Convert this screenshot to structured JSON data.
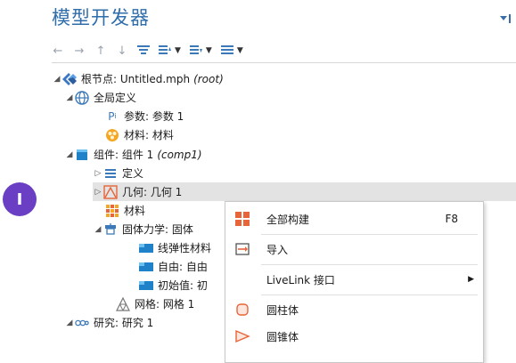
{
  "panel": {
    "title": "模型开发器",
    "pin_icon": "pin-dropdown-icon"
  },
  "toolbar": {
    "buttons": [
      {
        "icon": "arrow-left-icon",
        "glyph": "←"
      },
      {
        "icon": "arrow-right-icon",
        "glyph": "→"
      },
      {
        "icon": "arrow-up-icon",
        "glyph": "↑"
      },
      {
        "icon": "arrow-down-icon",
        "glyph": "↓"
      },
      {
        "icon": "filter-icon",
        "glyph": "≡"
      },
      {
        "icon": "expand-sort-icon",
        "glyph": "☰"
      },
      {
        "icon": "collapse-sort-icon",
        "glyph": "☰"
      },
      {
        "icon": "list-options-icon",
        "glyph": "☰"
      }
    ]
  },
  "tree": {
    "root": {
      "label": "根节点: Untitled.mph",
      "suffix": "(root)"
    },
    "global_defs": {
      "label": "全局定义"
    },
    "params": {
      "label": "参数: 参数 1"
    },
    "materials_global": {
      "label": "材料: 材料"
    },
    "component": {
      "label": "组件: 组件 1",
      "suffix": "(comp1)"
    },
    "definitions": {
      "label": "定义"
    },
    "geometry": {
      "label": "几何: 几何 1"
    },
    "materials": {
      "label": "材料"
    },
    "solid": {
      "label": "固体力学: 固体"
    },
    "linear_elastic": {
      "label": "线弹性材料"
    },
    "free": {
      "label": "自由: 自由"
    },
    "initial": {
      "label": "初始值: 初"
    },
    "mesh": {
      "label": "网格: 网格 1"
    },
    "study": {
      "label": "研究: 研究 1"
    }
  },
  "callout": {
    "label": "I"
  },
  "context_menu": {
    "items": [
      {
        "label": "全部构建",
        "shortcut": "F8",
        "icon": "build-all-icon"
      },
      {
        "label": "导入",
        "icon": "import-icon"
      },
      {
        "label": "LiveLink 接口",
        "icon": "",
        "submenu": true
      },
      {
        "label": "圆柱体",
        "icon": "cylinder-icon"
      },
      {
        "label": "圆锥体",
        "icon": "cone-icon"
      }
    ]
  },
  "colors": {
    "title": "#2f6dab",
    "accent_orange": "#e8643a",
    "badge": "#6a3fc4"
  }
}
